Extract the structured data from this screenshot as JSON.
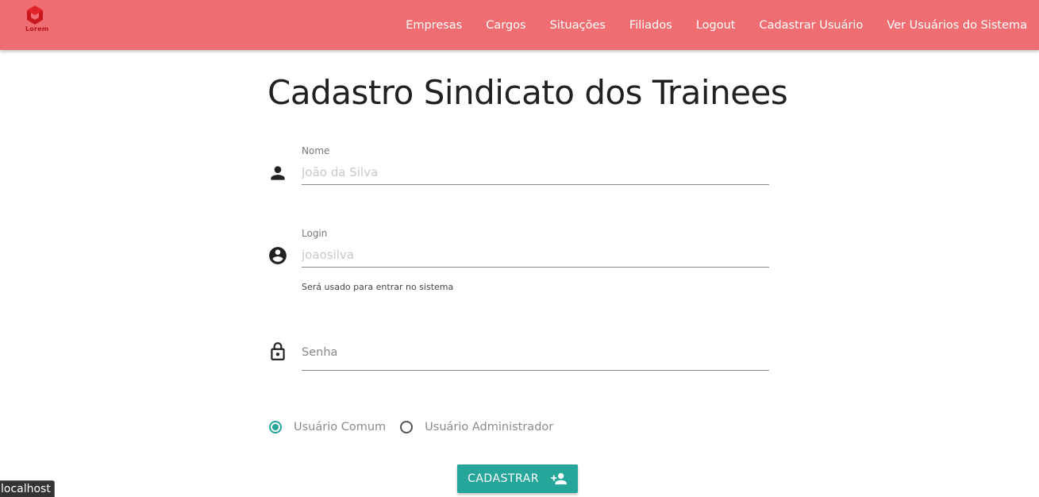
{
  "brand": {
    "logo_text": "Lorem"
  },
  "nav": {
    "links": [
      {
        "label": "Empresas"
      },
      {
        "label": "Cargos"
      },
      {
        "label": "Situações"
      },
      {
        "label": "Filiados"
      },
      {
        "label": "Logout"
      },
      {
        "label": "Cadastrar Usuário"
      },
      {
        "label": "Ver Usuários do Sistema"
      }
    ]
  },
  "page": {
    "title": "Cadastro Sindicato dos Trainees"
  },
  "form": {
    "nome": {
      "label": "Nome",
      "placeholder": "João da Silva",
      "icon": "person-icon"
    },
    "login": {
      "label": "Login",
      "placeholder": "joaosilva",
      "helper": "Será usado para entrar no sistema",
      "icon": "account-circle-icon"
    },
    "senha": {
      "label": "Senha",
      "icon": "lock-icon"
    },
    "tipo": {
      "options": [
        {
          "label": "Usuário Comum",
          "checked": true
        },
        {
          "label": "Usuário Administrador",
          "checked": false
        }
      ]
    },
    "submit": {
      "label": "CADASTRAR",
      "icon": "person-add-icon"
    }
  },
  "status_bar": {
    "text": "localhost"
  },
  "colors": {
    "navbar": "#f06e72",
    "accent": "#26a69a"
  }
}
